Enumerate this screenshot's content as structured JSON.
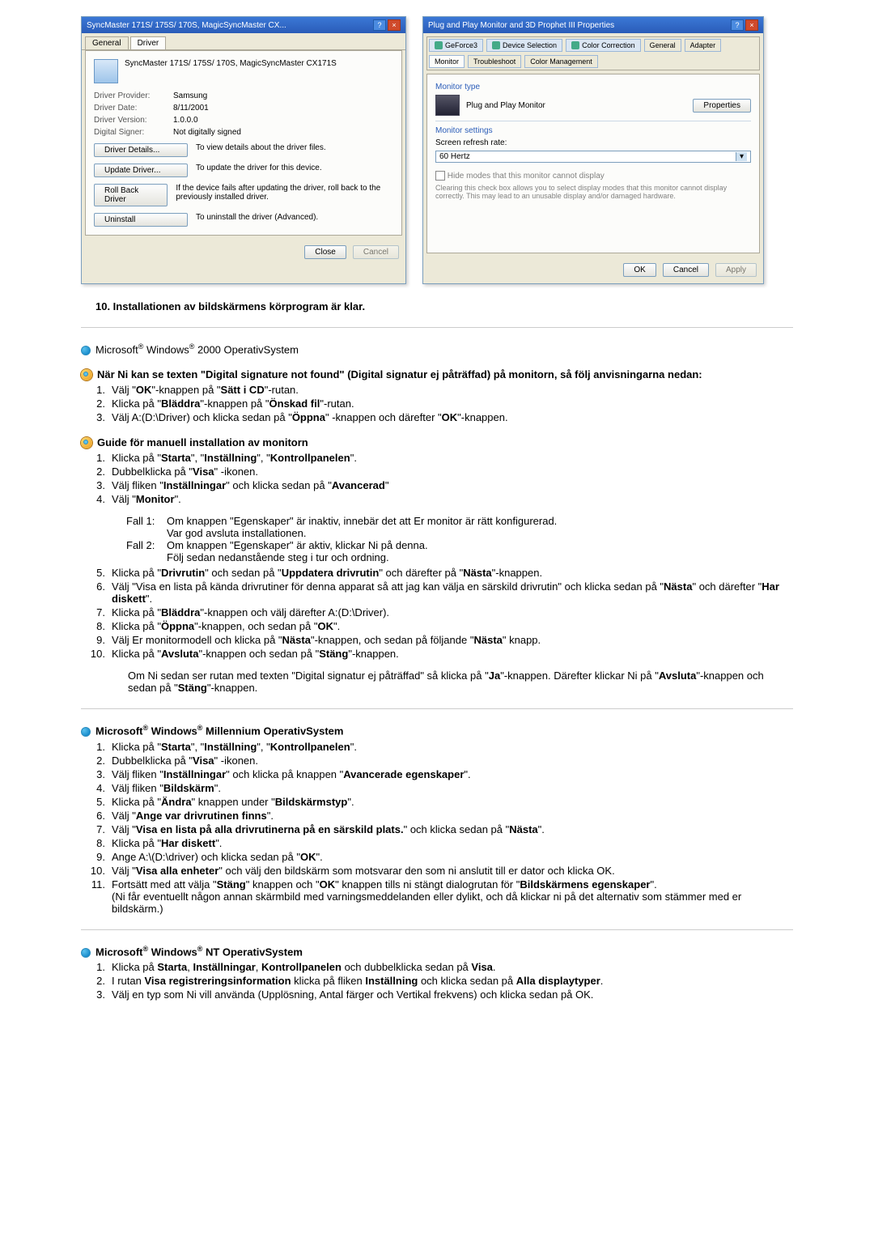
{
  "shots": {
    "left": {
      "title": "SyncMaster 171S/ 175S/ 170S, MagicSyncMaster CX...",
      "tab_general": "General",
      "tab_driver": "Driver",
      "heading": "SyncMaster 171S/ 175S/ 170S, MagicSyncMaster CX171S",
      "provider_l": "Driver Provider:",
      "provider_v": "Samsung",
      "date_l": "Driver Date:",
      "date_v": "8/11/2001",
      "version_l": "Driver Version:",
      "version_v": "1.0.0.0",
      "signer_l": "Digital Signer:",
      "signer_v": "Not digitally signed",
      "btn_details": "Driver Details...",
      "txt_details": "To view details about the driver files.",
      "btn_update": "Update Driver...",
      "txt_update": "To update the driver for this device.",
      "btn_rollback": "Roll Back Driver",
      "txt_rollback": "If the device fails after updating the driver, roll back to the previously installed driver.",
      "btn_uninstall": "Uninstall",
      "txt_uninstall": "To uninstall the driver (Advanced).",
      "btn_close": "Close",
      "btn_cancel": "Cancel"
    },
    "right": {
      "title": "Plug and Play Monitor and 3D Prophet III Properties",
      "tabs": [
        "GeForce3",
        "Device Selection",
        "Color Correction",
        "General",
        "Adapter",
        "Monitor",
        "Troubleshoot",
        "Color Management"
      ],
      "mt_label": "Monitor type",
      "mt_value": "Plug and Play Monitor",
      "mt_btn": "Properties",
      "ms_label": "Monitor settings",
      "refresh_label": "Screen refresh rate:",
      "refresh_value": "60 Hertz",
      "chk_label": "Hide modes that this monitor cannot display",
      "chk_help": "Clearing this check box allows you to select display modes that this monitor cannot display correctly. This may lead to an unusable display and/or damaged hardware.",
      "btn_ok": "OK",
      "btn_cancel": "Cancel",
      "btn_apply": "Apply"
    }
  },
  "step10": "10.  Installationen av bildskärmens körprogram är klar.",
  "heading_2000": "Microsoft® Windows® 2000 OperativSystem",
  "section_sig": {
    "title": "När Ni kan se texten \"Digital signature not found\" (Digital signatur ej påträffad) på monitorn, så följ anvisningarna nedan:",
    "items": [
      "Välj \"OK\"-knappen på \"Sätt i CD\"-rutan.",
      "Klicka på \"Bläddra\"-knappen på \"Önskad fil\"-rutan.",
      "Välj A:(D:\\Driver) och klicka sedan på \"Öppna\" -knappen och därefter \"OK\"-knappen."
    ]
  },
  "section_manual_title": "Guide för manuell installation av monitorn",
  "section_manual": {
    "items": [
      "Klicka på \"Starta\", \"Inställning\", \"Kontrollpanelen\".",
      "Dubbelklicka på \"Visa\" -ikonen.",
      "Välj fliken \"Inställningar\" och klicka sedan på \"Avancerad\"",
      "Välj \"Monitor\".",
      "Klicka på \"Drivrutin\" och sedan på \"Uppdatera drivrutin\" och därefter på \"Nästa\"-knappen.",
      "Välj \"Visa en lista på kända drivrutiner för denna apparat så att jag kan välja en särskild drivrutin\" och klicka sedan på \"Nästa\" och därefter \"Har diskett\".",
      "Klicka på \"Bläddra\"-knappen och välj därefter A:(D:\\Driver).",
      "Klicka på \"Öppna\"-knappen, och sedan på \"OK\".",
      "Välj Er monitormodell och klicka på \"Nästa\"-knappen, och sedan på följande \"Nästa\" knapp.",
      "Klicka på \"Avsluta\"-knappen och sedan på \"Stäng\"-knappen."
    ],
    "fall1_l": "Fall 1:",
    "fall1_a": "Om knappen \"Egenskaper\" är inaktiv, innebär det att Er monitor är rätt konfigurerad.",
    "fall1_b": "Var god avsluta installationen.",
    "fall2_l": "Fall 2:",
    "fall2_a": "Om knappen \"Egenskaper\" är aktiv, klickar Ni på denna.",
    "fall2_b": "Följ sedan nedanstående steg i tur och ordning.",
    "after": "Om Ni sedan ser rutan med texten \"Digital signatur ej påträffad\" så klicka på \"Ja\"-knappen. Därefter klickar Ni på \"Avsluta\"-knappen och sedan på \"Stäng\"-knappen."
  },
  "heading_me": "Microsoft® Windows® Millennium OperativSystem",
  "section_me": {
    "items": [
      "Klicka på \"Starta\", \"Inställning\", \"Kontrollpanelen\".",
      "Dubbelklicka på \"Visa\" -ikonen.",
      "Välj fliken \"Inställningar\" och klicka på knappen \"Avancerade egenskaper\".",
      "Välj fliken \"Bildskärm\".",
      "Klicka på \"Ändra\" knappen under \"Bildskärmstyp\".",
      "Välj \"Ange var drivrutinen finns\".",
      "Välj \"Visa en lista på alla drivrutinerna på en särskild plats.\" och klicka sedan på \"Nästa\".",
      "Klicka på \"Har diskett\".",
      "Ange A:\\(D:\\driver) och klicka sedan på \"OK\".",
      "Välj \"Visa alla enheter\" och välj den bildskärm som motsvarar den som ni anslutit till er dator och klicka OK.",
      "Fortsätt med att välja \"Stäng\" knappen och \"OK\" knappen tills ni stängt dialogrutan för \"Bildskärmens egenskaper\".\n(Ni får eventuellt någon annan skärmbild med varningsmeddelanden eller dylikt, och då klickar ni på det alternativ som stämmer med er bildskärm.)"
    ]
  },
  "heading_nt": "Microsoft® Windows® NT OperativSystem",
  "section_nt": {
    "items": [
      "Klicka på Starta, Inställningar, Kontrollpanelen och dubbelklicka sedan på Visa.",
      "I rutan Visa registreringsinformation klicka på fliken Inställning och klicka sedan på Alla displaytyper.",
      "Välj en typ som Ni vill använda (Upplösning, Antal färger och Vertikal frekvens) och klicka sedan på OK."
    ]
  }
}
